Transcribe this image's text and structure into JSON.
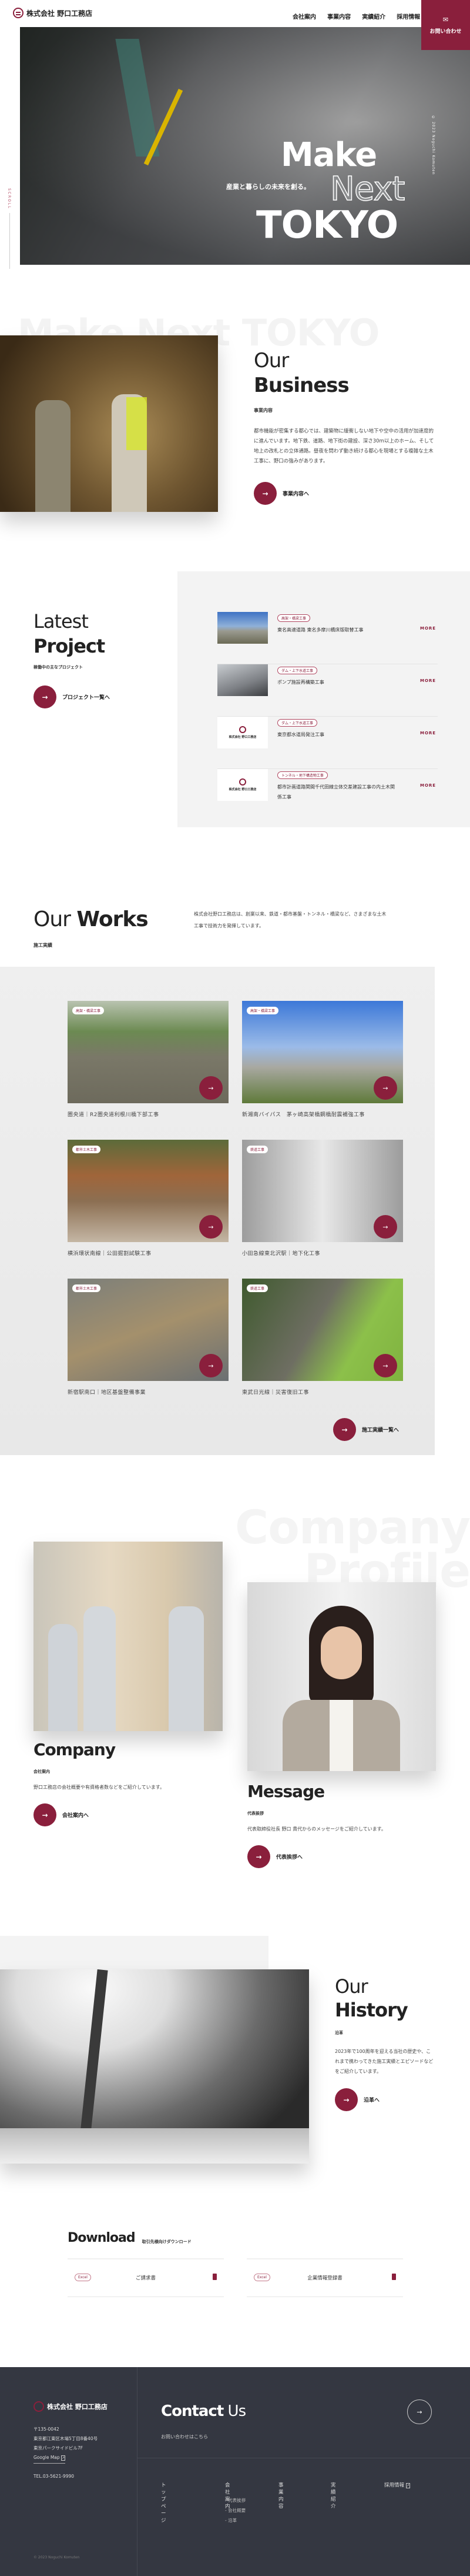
{
  "header": {
    "logo": "株式会社 野口工務店",
    "nav": [
      "会社案内",
      "事業内容",
      "実績紹介",
      "採用情報"
    ],
    "contact_label": "お問い合わせ",
    "contact_icon": "mail-icon"
  },
  "hero": {
    "line1": "Make",
    "line2": "Next",
    "line3": "TOKYO",
    "tagline": "産業と暮らしの未来を創る。",
    "copyright": "© 2023 Noguchi Komuten",
    "scroll": "SCROLL"
  },
  "business": {
    "bg_text": "Make Next TOKYO",
    "title1": "Our",
    "title2": "Business",
    "subtitle": "事業内容",
    "body": "都市機能が密集する都心では、建築物に緩衝しない地下や空中の活用が加速度的に進んでいます。地下鉄、道路、地下街の建設、深さ30m以上のホーム、そして地上の改札との立体通路。昼夜を問わず動き続ける都心を現場とする複雑な土木工事に、野口の強みがあります。",
    "button": "事業内容へ"
  },
  "latest": {
    "title1": "Latest",
    "title2": "Project",
    "subtitle": "稼働中の主なプロジェクト",
    "button": "プロジェクト一覧へ",
    "more_label": "MORE",
    "items": [
      {
        "tag": "高架・橋梁工事",
        "title": "東名高速道路 東名多摩川橋床版取替工事",
        "thumb": "photo"
      },
      {
        "tag": "ダム・上下水道工事",
        "title": "ポンプ施設再構築工事",
        "thumb": "photo"
      },
      {
        "tag": "ダム・上下水道工事",
        "title": "東京都水道局発注工事",
        "thumb": "logo"
      },
      {
        "tag": "トンネル・地下構造物工事",
        "title": "都市計画道路関間千代田線立体交差建設工事の内土木関係工事",
        "thumb": "logo"
      }
    ],
    "thumb_logo": "株式会社 野口工務店"
  },
  "works": {
    "title_light": "Our",
    "title_bold": "Works",
    "subtitle": "施工実績",
    "body": "株式会社野口工務店は、創業以来、鉄道・都市基盤・トンネル・橋梁など、さまざまな土木工事で技術力を発揮しています。",
    "items": [
      {
        "tag": "高架・橋梁工事",
        "title": "圏央道｜R2圏央道利根川橋下部工事"
      },
      {
        "tag": "高架・橋梁工事",
        "title": "新湘南バイパス　茅ヶ崎高架橋鋼橋耐震補強工事"
      },
      {
        "tag": "都市土木工事",
        "title": "横浜環状南線｜公田掘割試験工事"
      },
      {
        "tag": "鉄道工事",
        "title": "小田急線東北沢駅｜地下化工事"
      },
      {
        "tag": "都市土木工事",
        "title": "新宿駅南口｜地区基盤整備事業"
      },
      {
        "tag": "鉄道工事",
        "title": "東武日光線｜災害復旧工事"
      }
    ],
    "button": "施工実績一覧へ"
  },
  "company": {
    "bg_text1": "Company",
    "bg_text2": "Profile",
    "title": "Company",
    "subtitle": "会社案内",
    "body": "野口工務店の会社概要や有資格者数などをご紹介しています。",
    "button": "会社案内へ"
  },
  "message": {
    "title": "Message",
    "subtitle": "代表挨拶",
    "body": "代表取締役社長 野口 貴代からのメッセージをご紹介しています。",
    "button": "代表挨拶へ"
  },
  "history": {
    "title1": "Our",
    "title2": "History",
    "subtitle": "沿革",
    "body": "2023年で100周年を迎える当社の歴史や、これまで携わってきた施工実績とエピソードなどをご紹介しています。",
    "button": "沿革へ"
  },
  "download": {
    "title": "Download",
    "subtitle": "取引先様向けダウンロード",
    "items": [
      {
        "type": "Excel",
        "label": "ご請求書"
      },
      {
        "type": "Excel",
        "label": "企業情報登録書"
      }
    ]
  },
  "footer": {
    "logo": "株式会社 野口工務店",
    "postal": "〒135-0042",
    "address1": "東京都江東区木場5丁目8番40号",
    "address2": "東京パークサイドビル7F",
    "map_link": "Google Map",
    "tel": "TEL.03-5621-9990",
    "copyright": "© 2023 Noguchi Komuten",
    "contact_title_bold": "Contact",
    "contact_title_light": "Us",
    "contact_sub": "お問い合わせはこちら",
    "nav": [
      "トップページ",
      "会社案内",
      "事業内容",
      "実績紹介",
      "採用情報"
    ],
    "subnav": [
      "- 代表挨拶",
      "- 会社概要",
      "- 沿革"
    ]
  },
  "colors": {
    "accent": "#8a1f3c",
    "footer_bg": "#343741",
    "panel_bg": "#f3f3f3"
  }
}
